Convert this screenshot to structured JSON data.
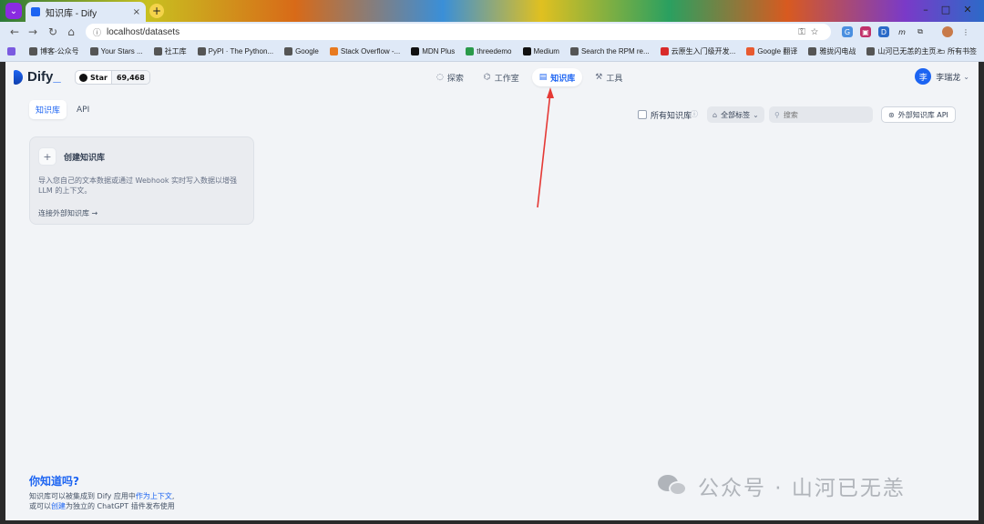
{
  "browser": {
    "tab_title": "知识库 - Dify",
    "tab_close": "×",
    "new_tab": "+",
    "url": "localhost/datasets",
    "bookmarks": [
      {
        "label": "博客-公众号"
      },
      {
        "label": "Your Stars ..."
      },
      {
        "label": "社工库"
      },
      {
        "label": "PyPI · The Python..."
      },
      {
        "label": "Google"
      },
      {
        "label": "Stack Overflow -..."
      },
      {
        "label": "MDN Plus"
      },
      {
        "label": "threedemo"
      },
      {
        "label": "Medium"
      },
      {
        "label": "Search the RPM re..."
      },
      {
        "label": "云原生入门级开发..."
      },
      {
        "label": "Google 翻译"
      },
      {
        "label": "雅拢闪电战"
      },
      {
        "label": "山河已无恙的主页..."
      }
    ],
    "bookmarks_more": "»",
    "all_bookmarks": "所有书签"
  },
  "app": {
    "logo_text": "Dify",
    "github_label": "Star",
    "github_count": "69,468",
    "nav": [
      {
        "label": "探索",
        "icon": "explore-icon",
        "active": false
      },
      {
        "label": "工作室",
        "icon": "studio-icon",
        "active": false
      },
      {
        "label": "知识库",
        "icon": "knowledge-icon",
        "active": true
      },
      {
        "label": "工具",
        "icon": "tools-icon",
        "active": false
      }
    ],
    "user_name": "李瑞龙",
    "user_initial": "李",
    "tabs": [
      {
        "label": "知识库",
        "active": true
      },
      {
        "label": "API",
        "active": false
      }
    ],
    "filters": {
      "all_knowledge_label": "所有知识库",
      "tag_filter_label": "全部标签",
      "search_placeholder": "搜索",
      "external_api_label": "外部知识库 API"
    },
    "create_card": {
      "title": "创建知识库",
      "description": "导入您自己的文本数据或通过 Webhook 实时写入数据以增强 LLM 的上下文。",
      "link": "连接外部知识库"
    },
    "tips": {
      "title": "你知道吗?",
      "line1_a": "知识库可以被集成到 Dify 应用中",
      "line1_b": "作为上下文",
      "line1_c": ",",
      "line2_a": "或可以",
      "line2_b": "创建",
      "line2_c": "为独立的 ChatGPT 插件发布使用"
    }
  },
  "watermark": "公众号 · 山河已无恙",
  "colors": {
    "accent": "#1c64f2",
    "annotation_arrow": "#e53935",
    "page_bg": "#f2f4f7"
  }
}
